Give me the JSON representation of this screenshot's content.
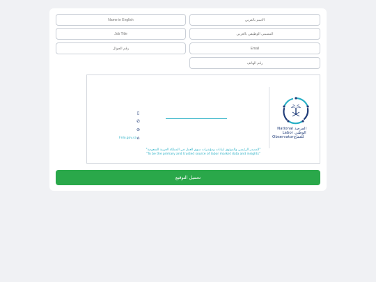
{
  "form": {
    "name_ar_placeholder": "الاسم بالعربي",
    "name_en_placeholder": "Name in English",
    "job_ar_placeholder": "المسمى الوظيفي بالعربي",
    "job_en_placeholder": "Job Title",
    "email_placeholder": "Email",
    "mobile_placeholder": "رقم الجوال",
    "phone_placeholder": "رقم الهاتف"
  },
  "signature": {
    "org_en": "National Labor Observatory",
    "org_ar": "المرصد الوطني للعمل",
    "website": "Fnlo.gov.sa",
    "tagline_ar": "\"المصدر الرئيسي والموثوق لبيانات ومؤشرات سوق العمل في المملكة العربية السعودية\"",
    "tagline_en": "\"To be the primary and trusted source of labor market data and insights\"",
    "icons": [
      "mobile-icon",
      "phone-icon",
      "email-icon",
      "website-icon"
    ]
  },
  "actions": {
    "download_label": "تحميل التوقيع"
  },
  "colors": {
    "accent": "#2aa84a",
    "brand_blue": "#1f3b78",
    "brand_teal": "#2ab0c6",
    "background": "#f0f1f4"
  }
}
